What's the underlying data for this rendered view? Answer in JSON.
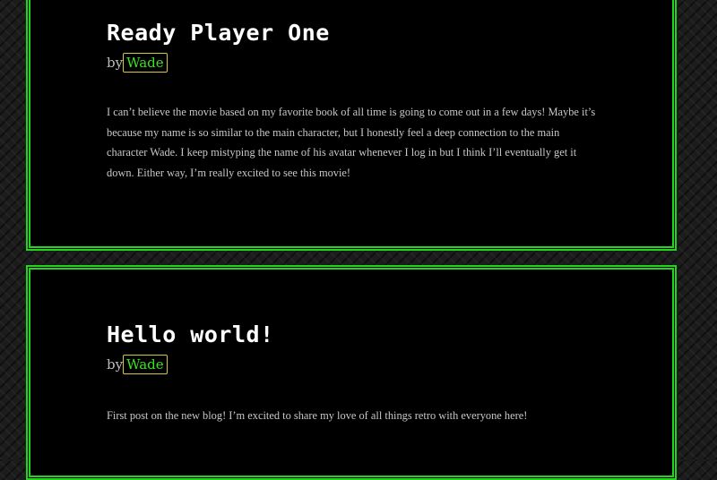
{
  "posts": [
    {
      "title": "Ready Player One",
      "by_label": "by",
      "author": "Wade",
      "body": "I can’t believe the movie based on my favorite book of all time is going to come out in a few days! Maybe it’s because my name is so similar to the main character, but I honestly feel a deep connection to the main character Wade. I keep mistyping the name of his avatar whenever I log in but I think I’ll eventually get it down. Either way, I’m really excited to see this movie!"
    },
    {
      "title": "Hello world!",
      "by_label": "by",
      "author": "Wade",
      "body": "First post on the new blog! I’m excited to share my love of all things retro with everyone here!"
    }
  ],
  "colors": {
    "border": "#22d41e",
    "author_link": "#39e41c",
    "author_outline": "#d6c93a",
    "post_background": "#000000",
    "page_background": "#1c1c1c"
  }
}
